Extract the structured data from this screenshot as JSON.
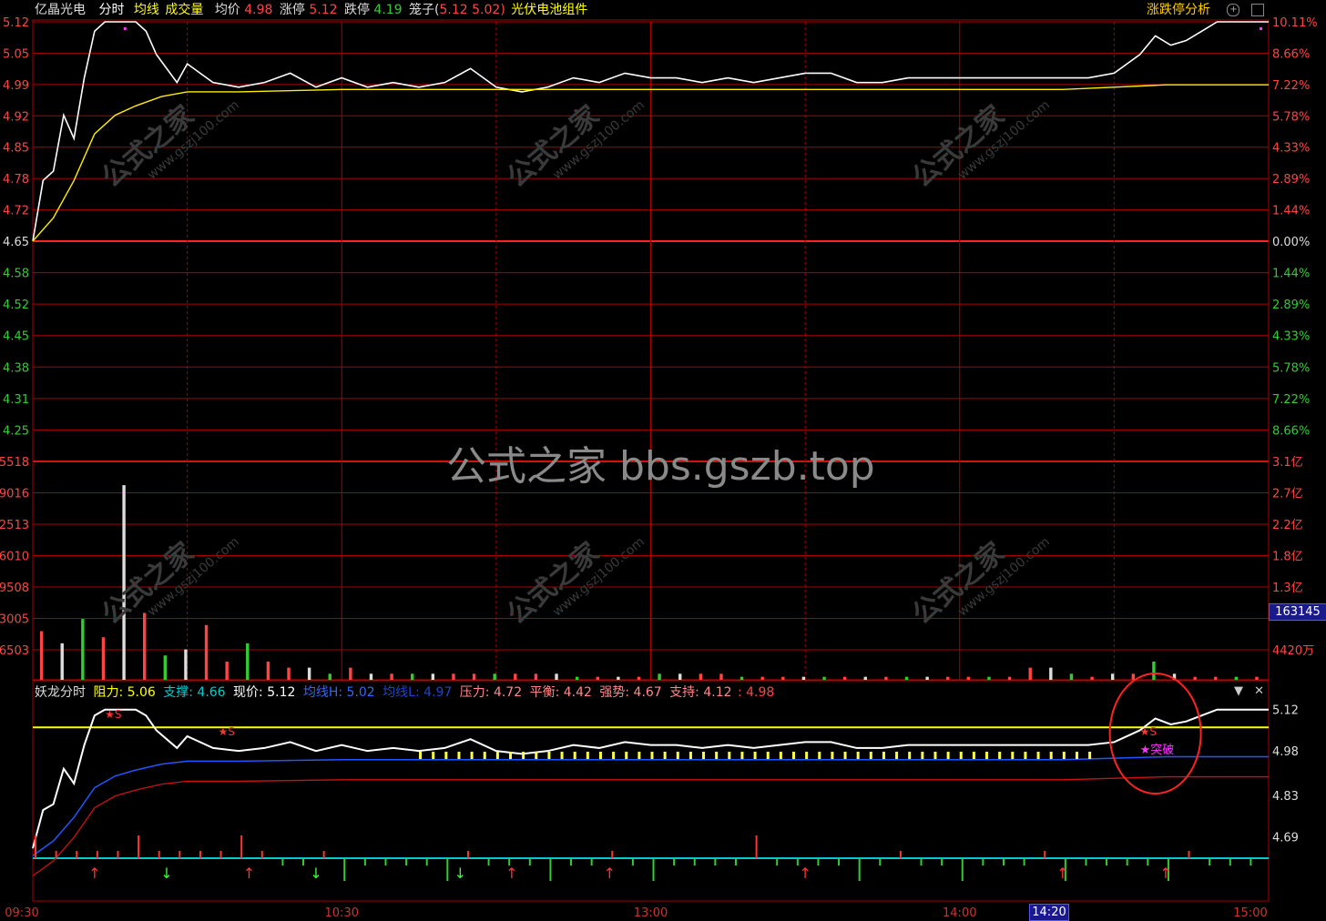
{
  "header": {
    "stock_name": "亿晶光电",
    "tab_fenshi": "分时",
    "tab_junxian": "均线",
    "tab_volume": "成交量",
    "avg_label": "均价",
    "avg_value": "4.98",
    "limit_up_label": "涨停",
    "limit_up_value": "5.12",
    "limit_down_label": "跌停",
    "limit_down_value": "4.19",
    "cage_label": "笼子(",
    "cage_low": "5.12",
    "cage_high": "5.02)",
    "sector": "光伏电池组件",
    "analysis_button": "涨跌停分析"
  },
  "indicator": {
    "name": "妖龙分时",
    "resist_label": "阻力:",
    "resist_value": "5.06",
    "support_label": "支撑:",
    "support_value": "4.66",
    "price_label": "现价:",
    "price_value": "5.12",
    "avgH_label": "均线H:",
    "avgH_value": "5.02",
    "avgL_label": "均线L:",
    "avgL_value": "4.97",
    "pressure_label": "压力:",
    "pressure_value": "4.72",
    "balance_label": "平衡:",
    "balance_value": "4.42",
    "strength_label": "强势:",
    "strength_value": "4.67",
    "hold_label": "支持:",
    "hold_value": "4.12",
    "last_value": ": 4.98"
  },
  "watermark": {
    "center": "公式之家 bbs.gszb.top",
    "small": "公式之家",
    "small_url": "www.gszj100.com"
  },
  "cursor_time": "14:20",
  "cursor_volume": "163145",
  "chart_data": {
    "type": "line",
    "price_axis_left": [
      "5.12",
      "5.05",
      "4.99",
      "4.92",
      "4.85",
      "4.78",
      "4.72",
      "4.65",
      "4.58",
      "4.52",
      "4.45",
      "4.38",
      "4.31",
      "4.25"
    ],
    "price_axis_right": [
      "10.11%",
      "8.66%",
      "7.22%",
      "5.78%",
      "4.33%",
      "2.89%",
      "1.44%",
      "0.00%",
      "1.44%",
      "2.89%",
      "4.33%",
      "5.78%",
      "7.22%",
      "8.66%"
    ],
    "volume_axis_left": [
      "5518",
      "9016",
      "2513",
      "6010",
      "9508",
      "3005",
      "6503"
    ],
    "volume_axis_right": [
      "3.1亿",
      "2.7亿",
      "2.2亿",
      "1.8亿",
      "1.3亿",
      "",
      "4420万"
    ],
    "indicator_axis_right": [
      "5.12",
      "4.98",
      "4.83",
      "4.69"
    ],
    "time_axis": [
      "09:30",
      "10:30",
      "13:00",
      "14:00",
      "15:00"
    ],
    "price_range": [
      4.19,
      5.12
    ],
    "prev_close": 4.65,
    "price_series": {
      "name": "",
      "x": [
        0,
        2,
        4,
        6,
        8,
        10,
        12,
        14,
        16,
        18,
        20,
        22,
        24,
        26,
        28,
        30,
        35,
        40,
        45,
        50,
        55,
        60,
        65,
        70,
        75,
        80,
        85,
        90,
        95,
        100,
        105,
        110,
        115,
        120,
        125,
        130,
        135,
        140,
        145,
        150,
        155,
        160,
        165,
        170,
        175,
        180,
        185,
        190,
        195,
        200,
        205,
        210,
        215,
        218,
        221,
        224,
        227,
        230,
        233,
        236,
        240
      ],
      "values": [
        4.65,
        4.78,
        4.8,
        4.92,
        4.87,
        5.0,
        5.1,
        5.12,
        5.12,
        5.12,
        5.12,
        5.1,
        5.05,
        5.02,
        4.99,
        5.03,
        4.99,
        4.98,
        4.99,
        5.01,
        4.98,
        5.0,
        4.98,
        4.99,
        4.98,
        4.99,
        5.02,
        4.98,
        4.97,
        4.98,
        5.0,
        4.99,
        5.01,
        5.0,
        5.0,
        4.99,
        5.0,
        4.99,
        5.0,
        5.01,
        5.01,
        4.99,
        4.99,
        5.0,
        5.0,
        5.0,
        5.0,
        5.0,
        5.0,
        5.0,
        5.0,
        5.01,
        5.05,
        5.09,
        5.07,
        5.08,
        5.1,
        5.12,
        5.12,
        5.12,
        5.12
      ]
    },
    "avg_series": {
      "name": "",
      "x": [
        0,
        4,
        8,
        12,
        16,
        20,
        25,
        30,
        40,
        60,
        80,
        100,
        120,
        140,
        160,
        180,
        200,
        210,
        220,
        240
      ],
      "values": [
        4.65,
        4.7,
        4.78,
        4.88,
        4.92,
        4.94,
        4.96,
        4.97,
        4.97,
        4.975,
        4.975,
        4.975,
        4.975,
        4.975,
        4.975,
        4.975,
        4.975,
        4.98,
        4.985,
        4.985
      ]
    },
    "volume_bars_100m": [
      0.8,
      0.6,
      1.0,
      0.7,
      3.2,
      1.1,
      0.4,
      0.5,
      0.9,
      0.3,
      0.6,
      0.3,
      0.2,
      0.2,
      0.1,
      0.2,
      0.1,
      0.1,
      0.1,
      0.1,
      0.1,
      0.1,
      0.1,
      0.1,
      0.1,
      0.1,
      0.05,
      0.05,
      0.05,
      0.05,
      0.1,
      0.1,
      0.1,
      0.1,
      0.05,
      0.05,
      0.05,
      0.05,
      0.05,
      0.05,
      0.05,
      0.05,
      0.05,
      0.05,
      0.05,
      0.05,
      0.05,
      0.05,
      0.2,
      0.2,
      0.1,
      0.05,
      0.1,
      0.1,
      0.3,
      0.1,
      0.05,
      0.05,
      0.05,
      0.05
    ],
    "indicator_lines": {
      "resist": 5.06,
      "support": 4.97,
      "breakout_labels": [
        "S",
        "S",
        "S",
        "突破"
      ]
    }
  }
}
